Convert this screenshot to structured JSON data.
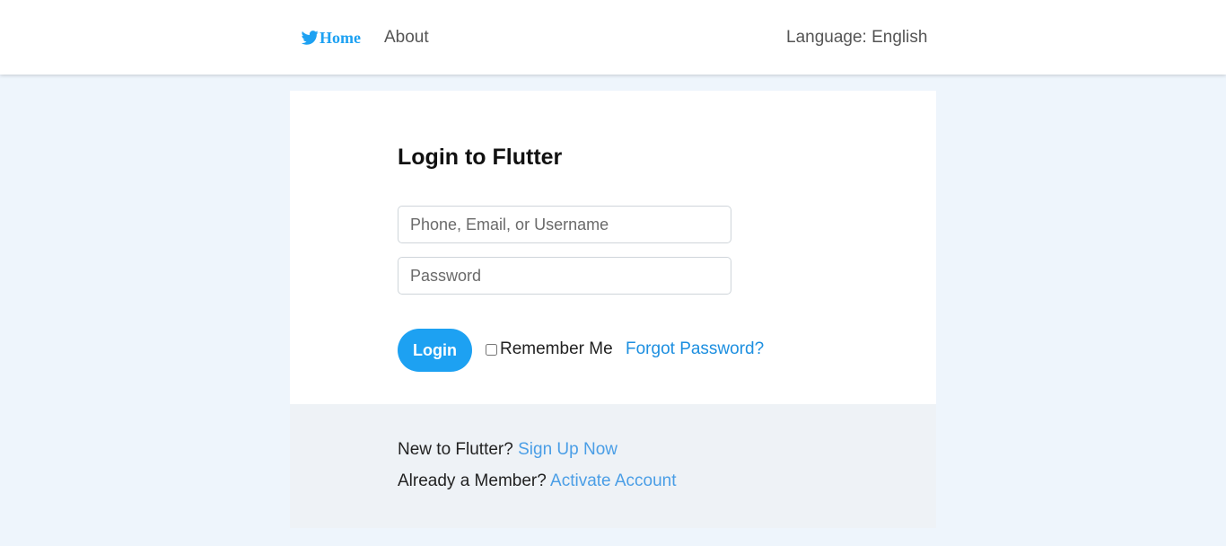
{
  "nav": {
    "home_label": "Home",
    "about_label": "About",
    "language_label": "Language: English",
    "brand_icon": "bird-icon",
    "brand_color": "#1da1f2"
  },
  "login": {
    "title": "Login to Flutter",
    "username_placeholder": "Phone, Email, or Username",
    "username_value": "",
    "password_placeholder": "Password",
    "password_value": "",
    "submit_label": "Login",
    "remember_label": "Remember Me",
    "remember_checked": false,
    "forgot_label": "Forgot Password?"
  },
  "footer": {
    "new_prompt": "New to Flutter?",
    "signup_link": "Sign Up Now",
    "member_prompt": "Already a Member?",
    "activate_link": "Activate Account"
  },
  "colors": {
    "accent": "#1da1f2",
    "link": "#1d8fe0",
    "page_background": "#eef5fc"
  }
}
